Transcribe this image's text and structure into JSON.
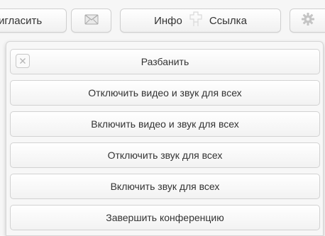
{
  "toolbar": {
    "invite_label": "игласить",
    "mail_icon": "envelope-icon",
    "info_label": "Инфо",
    "link_label": "Ссылка",
    "puzzle_icon": "puzzle-icon",
    "settings_icon": "gear-icon"
  },
  "menu": {
    "close_icon": "close-icon",
    "unban_label": "Разбанить",
    "items": [
      {
        "label": "Отключить видео и звук для всех"
      },
      {
        "label": "Включить видео и звук для всех"
      },
      {
        "label": "Отключить звук для всех"
      },
      {
        "label": "Включить звук для всех"
      },
      {
        "label": "Завершить конференцию"
      }
    ]
  },
  "colors": {
    "background": "#f6f6f6",
    "button_border": "#cfcfcf",
    "text": "#333333"
  }
}
